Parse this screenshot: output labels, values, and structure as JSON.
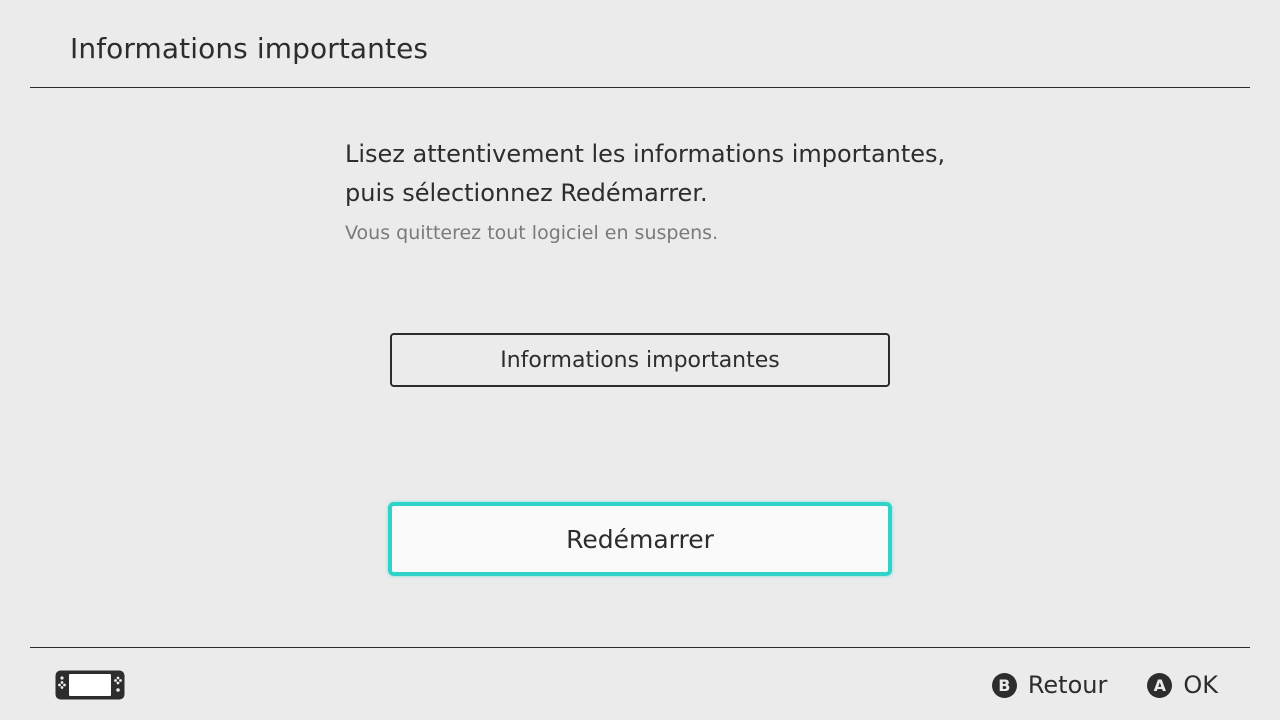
{
  "header": {
    "title": "Informations importantes"
  },
  "message": {
    "line1": "Lisez attentivement les informations importantes,",
    "line2": "puis sélectionnez Redémarrer.",
    "note": "Vous quitterez tout logiciel en suspens."
  },
  "buttons": {
    "info_label": "Informations importantes",
    "restart_label": "Redémarrer"
  },
  "footer": {
    "console_icon": "handheld-console-icon",
    "actions": [
      {
        "glyph": "B",
        "label": "Retour",
        "icon": "b-button-icon"
      },
      {
        "glyph": "A",
        "label": "OK",
        "icon": "a-button-icon"
      }
    ]
  },
  "colors": {
    "background": "#ebebeb",
    "text": "#2d2d2d",
    "subtext": "#7a7a7a",
    "focus_highlight": "#2fd3c9"
  }
}
